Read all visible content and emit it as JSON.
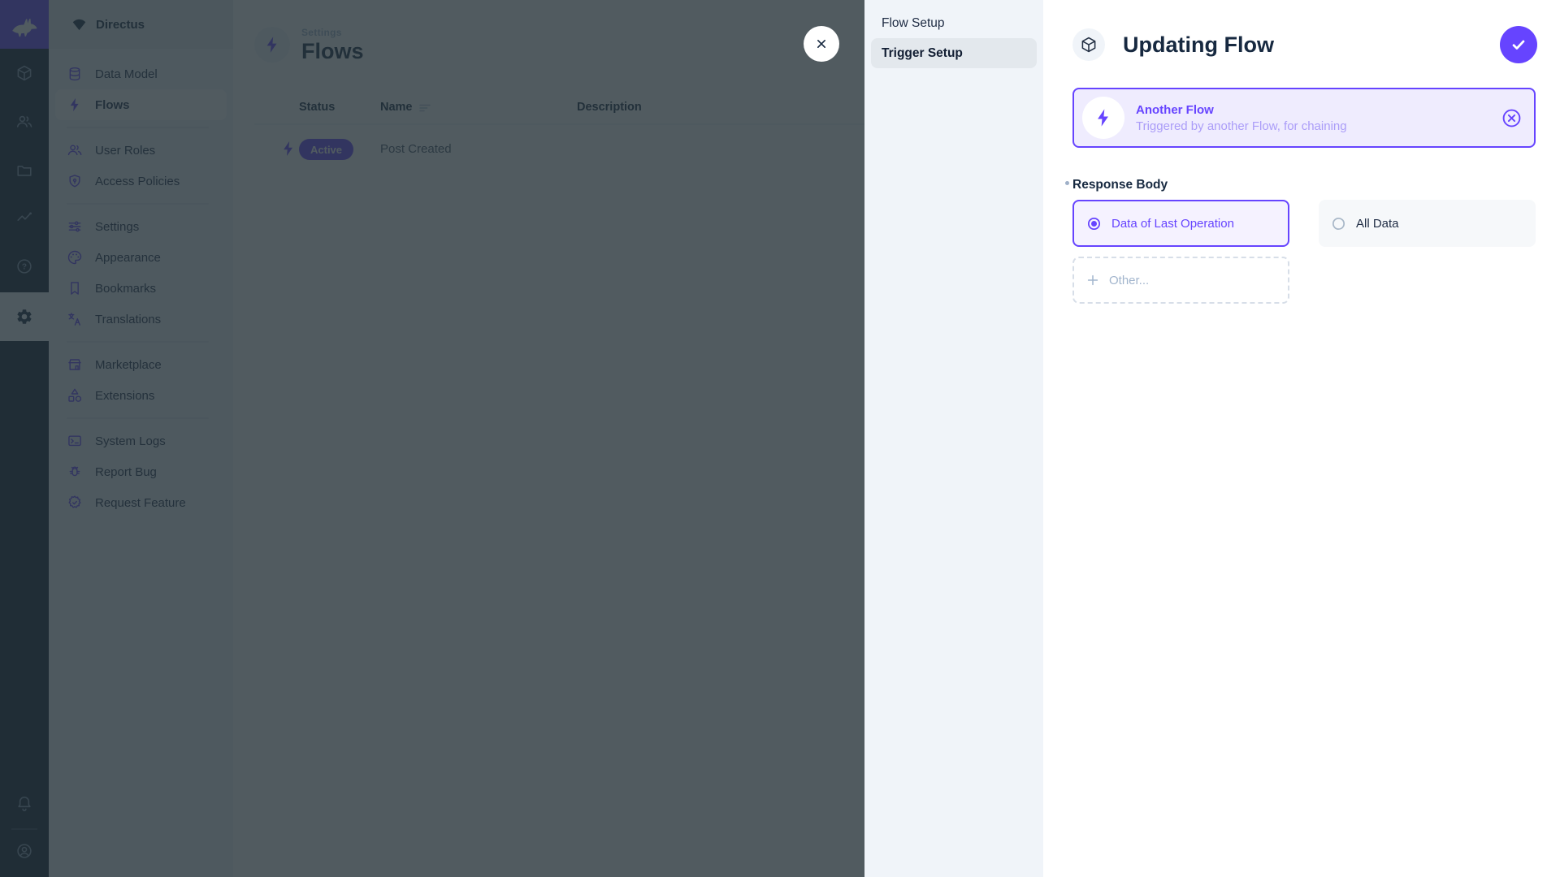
{
  "colors": {
    "accent": "#6644FF",
    "rail_background": "#0E1C2F",
    "nav_background": "#F0F4F9",
    "overlay": "rgba(38,50,56,0.8)",
    "active_badge_background": "#6644FF",
    "trigger_card_background": "#EFECFE"
  },
  "module_rail": {
    "logo_icon": "directus-rabbit-icon",
    "modules": [
      {
        "icon": "box-icon",
        "active": false
      },
      {
        "icon": "users-icon",
        "active": false
      },
      {
        "icon": "folder-icon",
        "active": false
      },
      {
        "icon": "activity-icon",
        "active": false
      },
      {
        "icon": "help-icon",
        "active": false
      },
      {
        "icon": "settings-gear-icon",
        "active": true
      }
    ],
    "bottom": [
      {
        "icon": "bell-icon"
      },
      {
        "icon": "avatar-icon"
      }
    ]
  },
  "sidebar": {
    "project_name": "Directus",
    "project_icon": "fan-icon",
    "items": [
      {
        "label": "Data Model",
        "icon": "database-icon",
        "active": false
      },
      {
        "label": "Flows",
        "icon": "bolt-icon",
        "active": true
      },
      {
        "label": "User Roles",
        "icon": "people-icon",
        "active": false
      },
      {
        "label": "Access Policies",
        "icon": "shield-lock-icon",
        "active": false
      },
      {
        "label": "Settings",
        "icon": "tune-icon",
        "active": false
      },
      {
        "label": "Appearance",
        "icon": "palette-icon",
        "active": false
      },
      {
        "label": "Bookmarks",
        "icon": "bookmark-icon",
        "active": false
      },
      {
        "label": "Translations",
        "icon": "translate-icon",
        "active": false
      },
      {
        "label": "Marketplace",
        "icon": "storefront-icon",
        "active": false
      },
      {
        "label": "Extensions",
        "icon": "category-icon",
        "active": false
      },
      {
        "label": "System Logs",
        "icon": "terminal-icon",
        "active": false
      },
      {
        "label": "Report Bug",
        "icon": "bug-icon",
        "active": false
      },
      {
        "label": "Request Feature",
        "icon": "feature-badge-icon",
        "active": false
      }
    ]
  },
  "page": {
    "breadcrumb": "Settings",
    "title": "Flows",
    "title_icon": "bolt-icon",
    "table": {
      "columns": [
        "Status",
        "Name",
        "Description"
      ],
      "rows": [
        {
          "status": "Active",
          "name": "Post Created",
          "description": "",
          "icon": "bolt-icon"
        }
      ]
    }
  },
  "drawer": {
    "nav": [
      {
        "label": "Flow Setup",
        "active": false
      },
      {
        "label": "Trigger Setup",
        "active": true
      }
    ],
    "title": "Updating Flow",
    "title_icon": "cube-icon",
    "save_icon": "check-icon",
    "trigger_card": {
      "icon": "bolt-icon",
      "title": "Another Flow",
      "subtitle": "Triggered by another Flow, for chaining",
      "cancel_icon": "cancel-circle-icon"
    },
    "fields": {
      "response_body": {
        "label": "Response Body",
        "required": true,
        "options": [
          {
            "label": "Data of Last Operation",
            "selected": true
          },
          {
            "label": "All Data",
            "selected": false
          }
        ],
        "other_label": "Other..."
      }
    }
  }
}
